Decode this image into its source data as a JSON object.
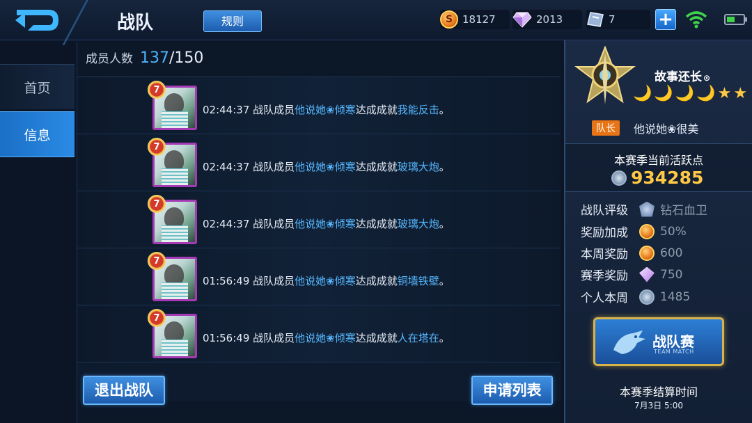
{
  "header": {
    "title": "战队",
    "rules_label": "规则",
    "gold": "18127",
    "diamonds": "2013",
    "vouchers": "7",
    "coin_symbol": "S"
  },
  "sidebar": {
    "items": [
      {
        "label": "首页",
        "active": false
      },
      {
        "label": "信息",
        "active": true
      }
    ]
  },
  "main": {
    "member_count_label": "成员人数",
    "member_current": "137",
    "member_max": "/150",
    "feed": [
      {
        "level": "7",
        "time": "02:44:37",
        "prefix": "战队成员",
        "member": "他说她❀倾寒",
        "mid": "达成成就",
        "achievement": "我能反击",
        "end": "。"
      },
      {
        "level": "7",
        "time": "02:44:37",
        "prefix": "战队成员",
        "member": "他说她❀倾寒",
        "mid": "达成成就",
        "achievement": "玻璃大炮",
        "end": "。"
      },
      {
        "level": "7",
        "time": "02:44:37",
        "prefix": "战队成员",
        "member": "他说她❀倾寒",
        "mid": "达成成就",
        "achievement": "玻璃大炮",
        "end": "。"
      },
      {
        "level": "7",
        "time": "01:56:49",
        "prefix": "战队成员",
        "member": "他说她❀倾寒",
        "mid": "达成成就",
        "achievement": "铜墙铁壁",
        "end": "。"
      },
      {
        "level": "7",
        "time": "01:56:49",
        "prefix": "战队成员",
        "member": "他说她❀倾寒",
        "mid": "达成成就",
        "achievement": "人在塔在",
        "end": "。"
      }
    ],
    "quit_label": "退出战队",
    "apply_label": "申请列表"
  },
  "info": {
    "team_name": "故事还长",
    "team_name_suffix": "⊙",
    "moons": 4,
    "stars": 2,
    "leader_tag": "队长",
    "leader_name": "他说她❀很美",
    "activity_label": "本赛季当前活跃点",
    "activity_value": "934285",
    "stats": [
      {
        "label": "战队评级",
        "icon": "rank-shield-icon",
        "value": "钻石血卫"
      },
      {
        "label": "奖励加成",
        "icon": "gold-coin-icon",
        "value": "50%"
      },
      {
        "label": "本周奖励",
        "icon": "gold-coin-icon",
        "value": "600"
      },
      {
        "label": "赛季奖励",
        "icon": "diamond-icon",
        "value": "750"
      },
      {
        "label": "个人本周",
        "icon": "activity-point-icon",
        "value": "1485"
      }
    ],
    "team_match_label": "战队赛",
    "team_match_sub": "TEAM MATCH",
    "settle_label": "本赛季结算时间",
    "settle_date": "7月3日 5:00"
  },
  "colors": {
    "accent_blue": "#4eb3ff",
    "highlight_gold": "#ffc845",
    "leader_orange": "#e87416"
  }
}
